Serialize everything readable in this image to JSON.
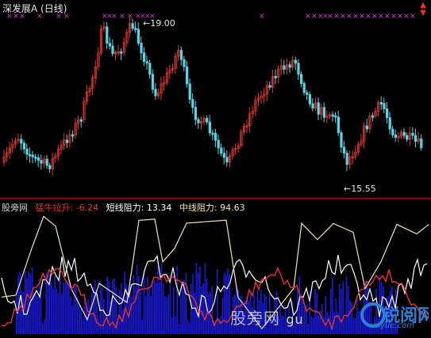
{
  "window": {
    "title": "深发展A (日线)"
  },
  "price_panel": {
    "high_label": "19.00",
    "low_label": "←15.55",
    "high_arrow": "←",
    "marker_symbol": "×"
  },
  "indicator_panel": {
    "name": "股旁网",
    "items": [
      {
        "label": "猛牛拉升:",
        "value": "-6.24",
        "color": "#e4352b"
      },
      {
        "label": "短线阻力:",
        "value": "13.34",
        "color": "#ffffff"
      },
      {
        "label": "中线阻力:",
        "value": "94.63",
        "color": "#f2e8b0"
      }
    ]
  },
  "watermark": {
    "left_text": "股旁网",
    "domain": "gu",
    "logo_text": "锐阅网",
    "site": "raiyue.com"
  },
  "colors": {
    "up_candle": "#e4352b",
    "down_candle": "#54d8e8",
    "marker": "#d830d8",
    "histogram": "#1a1ae0",
    "white_line": "#ffffff",
    "cream_line": "#f2e8b0",
    "red_line": "#e4352b"
  },
  "icons": {
    "corner": "up-down-arrows-icon"
  }
}
